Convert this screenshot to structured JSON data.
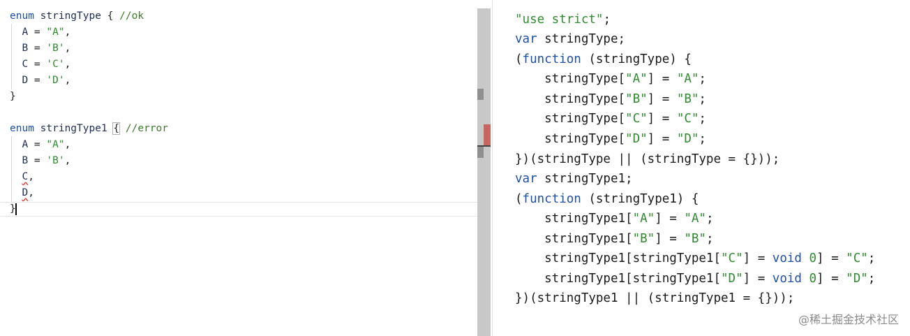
{
  "colors": {
    "keyword": "#1e4fa8",
    "string": "#2e8b2e",
    "comment": "#3d7a2a",
    "error_squiggle": "#e0453a",
    "scroll_marker": "#c9675e"
  },
  "left_editor": {
    "line1_keyword": "enum",
    "line1_name": "stringType",
    "line1_brace": "{",
    "line1_comment": "//ok",
    "line2_prop": "A",
    "line2_eq": " = ",
    "line2_val": "\"A\"",
    "line2_comma": ",",
    "line3_prop": "B",
    "line3_eq": " = ",
    "line3_val": "'B'",
    "line3_comma": ",",
    "line4_prop": "C",
    "line4_eq": " = ",
    "line4_val": "'C'",
    "line4_comma": ",",
    "line5_prop": "D",
    "line5_eq": " = ",
    "line5_val": "'D'",
    "line5_comma": ",",
    "line6_close": "}",
    "line8_keyword": "enum",
    "line8_name": "stringType1",
    "line8_brace": "{",
    "line8_comment": "//error",
    "line9_prop": "A",
    "line9_eq": " = ",
    "line9_val": "\"A\"",
    "line9_comma": ",",
    "line10_prop": "B",
    "line10_eq": " = ",
    "line10_val": "'B'",
    "line10_comma": ",",
    "line11_prop": "C",
    "line11_comma": ",",
    "line12_prop": "D",
    "line12_comma": ",",
    "line13_close": "}"
  },
  "right_output": {
    "l1": "\"use strict\"",
    "l1_semi": ";",
    "l2_kw": "var",
    "l2_rest": " stringType;",
    "l3_open": "(",
    "l3_kw": "function",
    "l3_rest": " (stringType) {",
    "l4_pre": "    stringType[",
    "l4_key": "\"A\"",
    "l4_mid": "] = ",
    "l4_val": "\"A\"",
    "l4_end": ";",
    "l5_pre": "    stringType[",
    "l5_key": "\"B\"",
    "l5_mid": "] = ",
    "l5_val": "\"B\"",
    "l5_end": ";",
    "l6_pre": "    stringType[",
    "l6_key": "\"C\"",
    "l6_mid": "] = ",
    "l6_val": "\"C\"",
    "l6_end": ";",
    "l7_pre": "    stringType[",
    "l7_key": "\"D\"",
    "l7_mid": "] = ",
    "l7_val": "\"D\"",
    "l7_end": ";",
    "l8": "})(stringType || (stringType = {}));",
    "l9_kw": "var",
    "l9_rest": " stringType1;",
    "l10_open": "(",
    "l10_kw": "function",
    "l10_rest": " (stringType1) {",
    "l11_pre": "    stringType1[",
    "l11_key": "\"A\"",
    "l11_mid": "] = ",
    "l11_val": "\"A\"",
    "l11_end": ";",
    "l12_pre": "    stringType1[",
    "l12_key": "\"B\"",
    "l12_mid": "] = ",
    "l12_val": "\"B\"",
    "l12_end": ";",
    "l13_pre": "    stringType1[stringType1[",
    "l13_key": "\"C\"",
    "l13_mid": "] = ",
    "l13_void": "void",
    "l13_zero": " 0",
    "l13_mid2": "] = ",
    "l13_val": "\"C\"",
    "l13_end": ";",
    "l14_pre": "    stringType1[stringType1[",
    "l14_key": "\"D\"",
    "l14_mid": "] = ",
    "l14_void": "void",
    "l14_zero": " 0",
    "l14_mid2": "] = ",
    "l14_val": "\"D\"",
    "l14_end": ";",
    "l15": "})(stringType1 || (stringType1 = {}));"
  },
  "watermark": "@稀土掘金技术社区"
}
